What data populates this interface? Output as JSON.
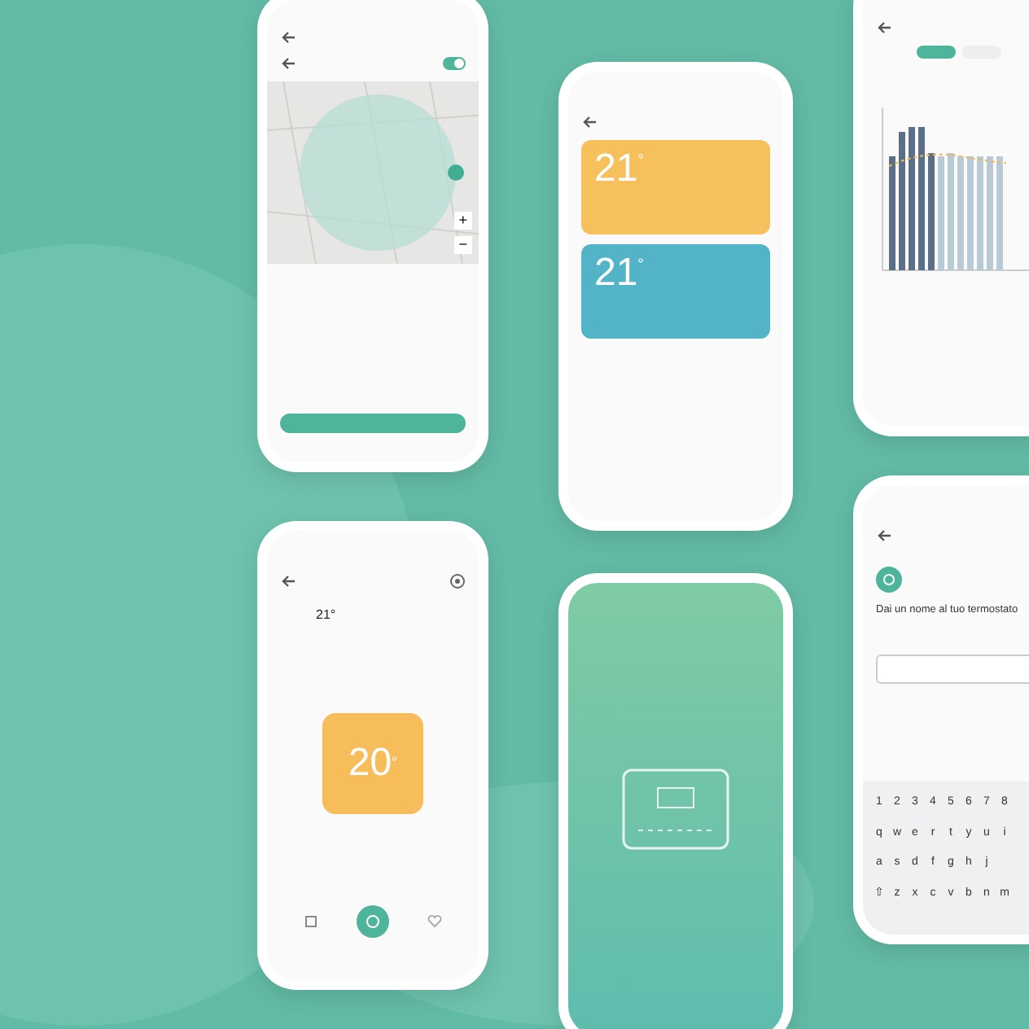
{
  "geofence_screen": {
    "toggle_on": true,
    "zoom_controls": [
      "+",
      "−"
    ]
  },
  "thermostats_screen": {
    "cards": [
      {
        "temperature": "21",
        "unit": "°",
        "color": "#f6c15c"
      },
      {
        "temperature": "21",
        "unit": "°",
        "color": "#52b4c6"
      }
    ]
  },
  "history_screen": {
    "tabs": [
      {
        "selected": true
      },
      {
        "selected": false
      }
    ]
  },
  "thermostat_screen": {
    "current": "21°",
    "setpoint": "20",
    "unit": "°",
    "color": "#f6bd5a",
    "nav": [
      {
        "kind": "list",
        "selected": false
      },
      {
        "kind": "power",
        "selected": true
      },
      {
        "kind": "heart",
        "selected": false
      }
    ]
  },
  "name_screen": {
    "heading": "Dai un nome al tuo termostato",
    "keyboard": [
      [
        "1",
        "2",
        "3",
        "4",
        "5",
        "6",
        "7",
        "8"
      ],
      [
        "q",
        "w",
        "e",
        "r",
        "t",
        "y",
        "u",
        "i"
      ],
      [
        "a",
        "s",
        "d",
        "f",
        "g",
        "h",
        "j"
      ],
      [
        "⇧",
        "z",
        "x",
        "c",
        "v",
        "b",
        "n",
        "m"
      ]
    ]
  }
}
